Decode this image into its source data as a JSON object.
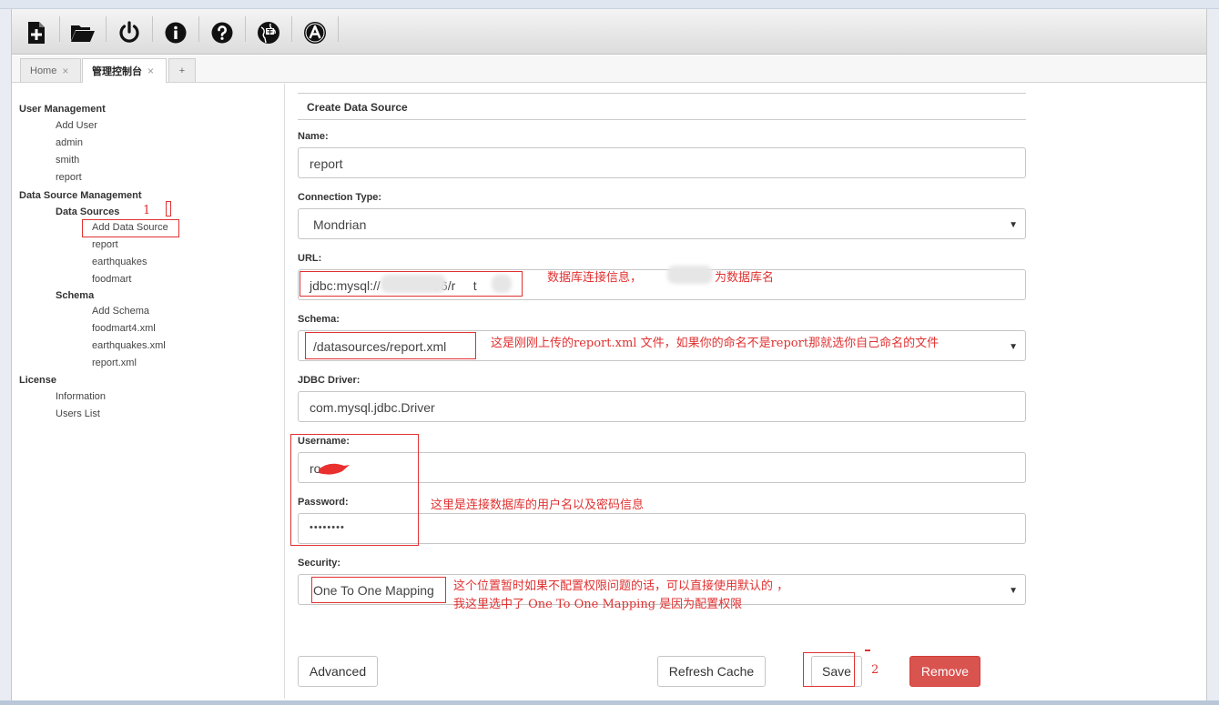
{
  "tabs": [
    {
      "label": "Home",
      "close": "×"
    },
    {
      "label": "管理控制台",
      "close": "×"
    },
    {
      "label": "+"
    }
  ],
  "sidebar": {
    "user_management": "User Management",
    "add_user": "Add User",
    "users": [
      "admin",
      "smith",
      "report"
    ],
    "data_source_management": "Data Source Management",
    "data_sources": "Data Sources",
    "add_data_source": "Add Data Source",
    "sources": [
      "report",
      "earthquakes",
      "foodmart"
    ],
    "schema": "Schema",
    "add_schema": "Add Schema",
    "schemas": [
      "foodmart4.xml",
      "earthquakes.xml",
      "report.xml"
    ],
    "license": "License",
    "information": "Information",
    "users_list": "Users List"
  },
  "form": {
    "title": "Create Data Source",
    "name_label": "Name:",
    "name_value": "report",
    "connection_type_label": "Connection Type:",
    "connection_type_value": "Mondrian",
    "url_label": "URL:",
    "url_value": "jdbc:mysql://               06/r     t",
    "schema_label": "Schema:",
    "schema_value": "/datasources/report.xml",
    "jdbc_driver_label": "JDBC Driver:",
    "jdbc_driver_value": "com.mysql.jdbc.Driver",
    "username_label": "Username:",
    "username_value": "ro",
    "password_label": "Password:",
    "password_value": "••••••••",
    "security_label": "Security:",
    "security_value": "One To One Mapping"
  },
  "buttons": {
    "advanced": "Advanced",
    "refresh_cache": "Refresh Cache",
    "save": "Save",
    "remove": "Remove"
  },
  "annotations": {
    "step1": "1",
    "step2": "2",
    "url_note_a": "数据库连接信息，",
    "url_note_b": "为数据库名",
    "schema_note": "这是刚刚上传的report.xml 文件，如果你的命名不是report那就选你自己命名的文件",
    "credentials_note": "这里是连接数据库的用户名以及密码信息",
    "security_note_1": "这个位置暂时如果不配置权限问题的话，可以直接使用默认的 ，",
    "security_note_2": "我这里选中了 One To One Mapping 是因为配置权限"
  },
  "colors": {
    "annotation": "#e03131",
    "remove_button": "#d9534f"
  }
}
